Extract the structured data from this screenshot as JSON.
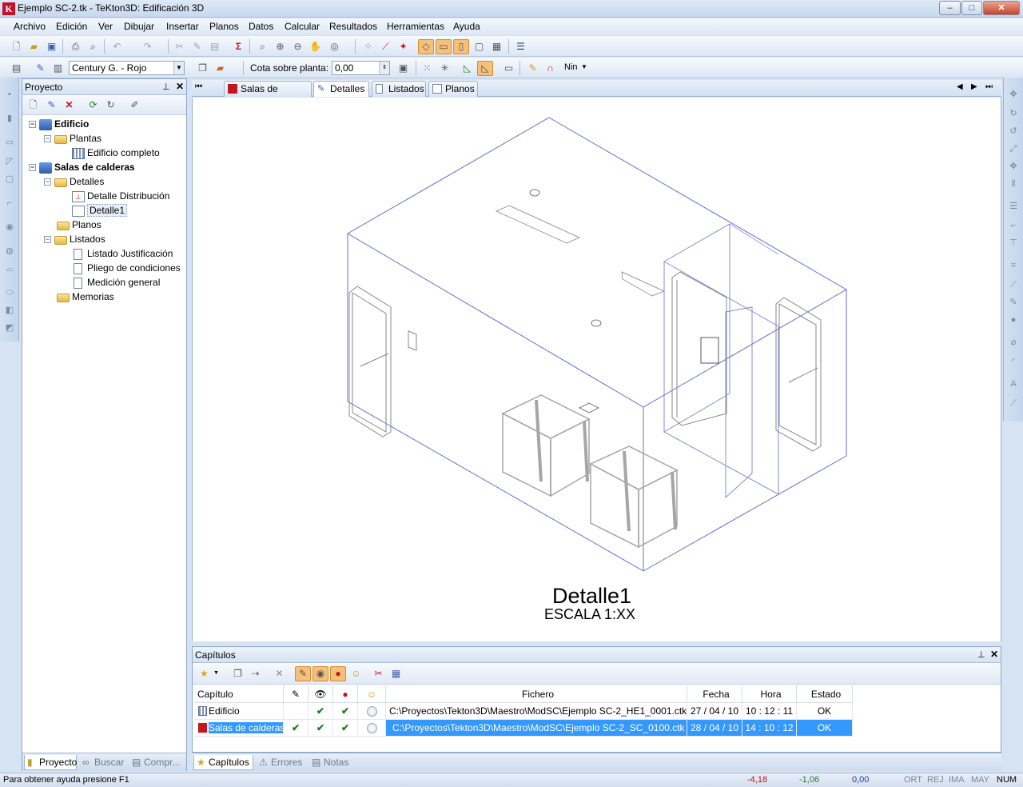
{
  "window": {
    "app_icon": "K",
    "title": "Ejemplo SC-2.tk - TeKton3D: Edificación 3D",
    "minimize": "–",
    "maximize": "□",
    "close": "✕"
  },
  "menu": [
    "Archivo",
    "Edición",
    "Ver",
    "Dibujar",
    "Insertar",
    "Planos",
    "Datos",
    "Calcular",
    "Resultados",
    "Herramientas",
    "Ayuda"
  ],
  "toolbar2": {
    "style_combo": "Century G. - Rojo",
    "cota_label": "Cota sobre planta:",
    "cota_value": "0,00",
    "snap_label": "Nin"
  },
  "project": {
    "title": "Proyecto",
    "tree": [
      {
        "label": "Edificio",
        "bold": true,
        "level": 0,
        "icon": "building-icon"
      },
      {
        "label": "Plantas",
        "bold": false,
        "level": 1,
        "icon": "folder-icon"
      },
      {
        "label": "Edificio completo",
        "bold": false,
        "level": 2,
        "icon": "grid-icon"
      },
      {
        "label": "Salas de calderas",
        "bold": true,
        "level": 0,
        "icon": "building-icon"
      },
      {
        "label": "Detalles",
        "bold": false,
        "level": 1,
        "icon": "folder-icon"
      },
      {
        "label": "Detalle Distribución",
        "bold": false,
        "level": 2,
        "icon": "chart-icon"
      },
      {
        "label": "Detalle1",
        "bold": false,
        "level": 2,
        "icon": "detail-icon"
      },
      {
        "label": "Planos",
        "bold": false,
        "level": 1,
        "icon": "folder-icon"
      },
      {
        "label": "Listados",
        "bold": false,
        "level": 1,
        "icon": "folder-icon"
      },
      {
        "label": "Listado Justificación",
        "bold": false,
        "level": 2,
        "icon": "document-icon"
      },
      {
        "label": "Pliego de condiciones",
        "bold": false,
        "level": 2,
        "icon": "document-icon"
      },
      {
        "label": "Medición general",
        "bold": false,
        "level": 2,
        "icon": "document-icon"
      },
      {
        "label": "Memorias",
        "bold": false,
        "level": 1,
        "icon": "folder-icon"
      }
    ],
    "tabs": [
      "Proyecto",
      "Buscar",
      "Compr..."
    ]
  },
  "doc_tabs": [
    "Salas de calderas",
    "Detalles",
    "Listados",
    "Planos"
  ],
  "drawing": {
    "title": "Detalle1",
    "scale": "ESCALA 1:XX"
  },
  "capitulos": {
    "title": "Capítulos",
    "columns": [
      "Capítulo",
      "",
      "",
      "",
      "",
      "Fichero",
      "Fecha",
      "Hora",
      "Estado"
    ],
    "rows": [
      {
        "name": "Edificio",
        "c1": "",
        "c2": "✔",
        "c3": "✔",
        "file": "C:\\Proyectos\\Tekton3D\\Maestro\\ModSC\\Ejemplo SC-2_HE1_0001.ctk",
        "date": "27 / 04 / 10",
        "time": "10 : 12 : 11",
        "status": "OK"
      },
      {
        "name": "Salas de calderas",
        "c1": "✔",
        "c2": "✔",
        "c3": "✔",
        "file": "C:\\Proyectos\\Tekton3D\\Maestro\\ModSC\\Ejemplo SC-2_SC_0100.ctk",
        "date": "28 / 04 / 10",
        "time": "14 : 10 : 12",
        "status": "OK"
      }
    ],
    "tabs": [
      "Capítulos",
      "Errores",
      "Notas"
    ]
  },
  "status": {
    "help": "Para obtener ayuda presione F1",
    "x": "-4,18",
    "y": "-1,06",
    "z": "0,00",
    "flags": [
      "ORT",
      "REJ",
      "IMA",
      "MAY",
      "NUM"
    ]
  },
  "colors": {
    "accent": "#3399ff",
    "drawing_line": "#6b6bd6",
    "equipment": "#a6a6a6"
  }
}
